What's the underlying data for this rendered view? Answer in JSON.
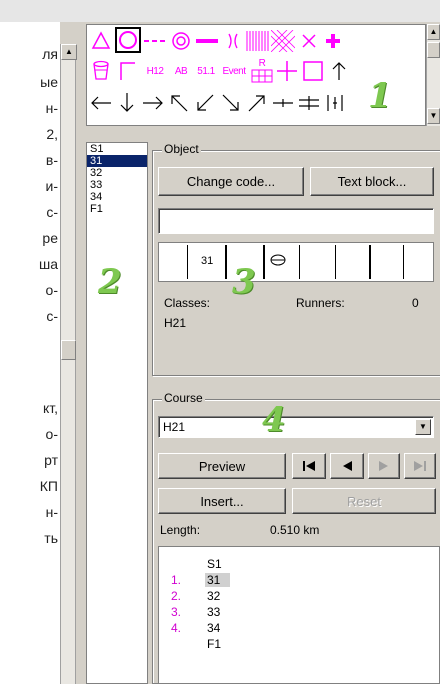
{
  "page_text_lines": [
    "ля",
    "ые",
    "н-",
    "2,",
    "в-",
    "и-",
    "с-",
    "ре",
    "ша",
    "о-",
    "с-",
    "кт,",
    "о-",
    "рт",
    "КП",
    "н-",
    "ть"
  ],
  "palette": {
    "row2_labels": [
      "H12",
      "AB",
      "51.1",
      "Event"
    ],
    "control_start_letter": "R"
  },
  "control_list": {
    "items": [
      "S1",
      "31",
      "32",
      "33",
      "34",
      "F1"
    ],
    "selected_index": 1
  },
  "object": {
    "group_title": "Object",
    "change_code_label": "Change code...",
    "text_block_label": "Text block...",
    "text_value": "",
    "code_cell_label": "31",
    "classes_label": "Classes:",
    "classes_value": "H21",
    "runners_label": "Runners:",
    "runners_value": "0"
  },
  "course": {
    "group_title": "Course",
    "selected_course": "H21",
    "preview_label": "Preview",
    "insert_label": "Insert...",
    "reset_label": "Reset",
    "length_label": "Length:",
    "length_value": "0.510 km",
    "legs": [
      {
        "num": "",
        "code": "S1"
      },
      {
        "num": "1.",
        "code": "31"
      },
      {
        "num": "2.",
        "code": "32"
      },
      {
        "num": "3.",
        "code": "33"
      },
      {
        "num": "4.",
        "code": "34"
      },
      {
        "num": "",
        "code": "F1"
      }
    ],
    "highlighted_leg": 1
  },
  "annotations": [
    "1",
    "2",
    "3",
    "4"
  ],
  "colors": {
    "symbol_accent": "#ff00ff",
    "selection": "#0a246a",
    "annotation": "#7ec850",
    "window_face": "#d4d0c8"
  }
}
